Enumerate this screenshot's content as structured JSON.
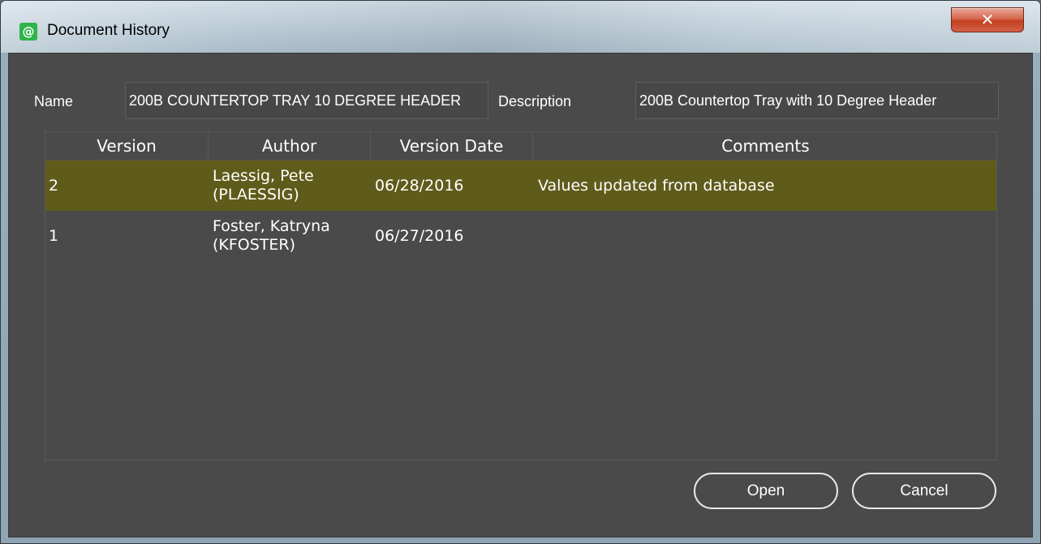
{
  "window": {
    "title": "Document History",
    "app_icon_glyph": "@",
    "close_glyph": "✕"
  },
  "fields": {
    "name_label": "Name",
    "name_value": "200B COUNTERTOP TRAY 10 DEGREE HEADER",
    "description_label": "Description",
    "description_value": "200B Countertop Tray with 10 Degree Header"
  },
  "table": {
    "columns": [
      "Version",
      "Author",
      "Version Date",
      "Comments"
    ],
    "rows": [
      {
        "version": "2",
        "author_line1": "Laessig, Pete",
        "author_line2": "(PLAESSIG)",
        "date": "06/28/2016",
        "comment": "Values updated from database",
        "selected": true
      },
      {
        "version": "1",
        "author_line1": "Foster, Katryna",
        "author_line2": "(KFOSTER)",
        "date": "06/27/2016",
        "comment": "",
        "selected": false
      }
    ]
  },
  "buttons": {
    "open_label": "Open",
    "cancel_label": "Cancel"
  },
  "colors": {
    "selected_row": "#5f5b1a",
    "background": "#4a4a4a"
  }
}
